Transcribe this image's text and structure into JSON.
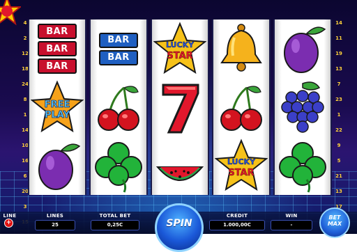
{
  "line_numbers_left": [
    "4",
    "2",
    "12",
    "18",
    "24",
    "8",
    "1",
    "14",
    "10",
    "16",
    "6",
    "20",
    "3",
    "15"
  ],
  "line_numbers_right": [
    "14",
    "11",
    "19",
    "13",
    "7",
    "23",
    "1",
    "22",
    "9",
    "5",
    "21",
    "13",
    "17",
    "17"
  ],
  "reels": [
    {
      "symbols": [
        "bar-triple",
        "free-play-star",
        "plum"
      ]
    },
    {
      "symbols": [
        "bar-double",
        "cherries",
        "clover"
      ]
    },
    {
      "symbols": [
        "lucky-star",
        "seven",
        "watermelon"
      ]
    },
    {
      "symbols": [
        "bell",
        "cherries",
        "lucky-star"
      ]
    },
    {
      "symbols": [
        "plum",
        "grapes",
        "clover"
      ]
    }
  ],
  "symbol_text": {
    "bar": "BAR",
    "free_play": [
      "FREE",
      "PLAY"
    ],
    "lucky_star": [
      "LUCKY",
      "STAR"
    ]
  },
  "hud": {
    "line": {
      "label": "LINE",
      "value": ""
    },
    "lines": {
      "label": "LINES",
      "value": "25"
    },
    "total_bet": {
      "label": "TOTAL BET",
      "value": "0,25C"
    },
    "credit": {
      "label": "CREDIT",
      "value": "1.000,00C"
    },
    "win": {
      "label": "WIN",
      "value": "-"
    },
    "spin": "SPIN",
    "bet_max": [
      "BET",
      "MAX"
    ],
    "plus": "+"
  },
  "colors": {
    "accent_yellow": "#ffd23a",
    "bar_red": "#c8102e",
    "bar_blue": "#1f5fc1",
    "spin_blue": "#1a58d8"
  }
}
